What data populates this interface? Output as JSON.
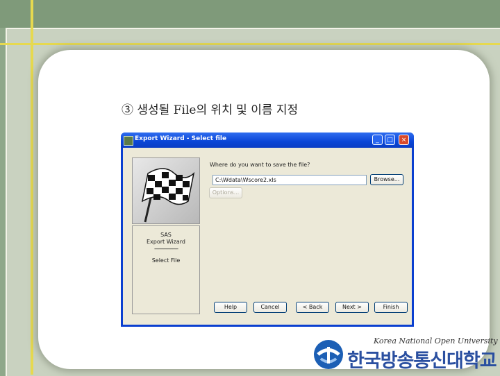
{
  "slide": {
    "title": "③ 생성될 File의 위치 및 이름 지정"
  },
  "dialog": {
    "title": "Export Wizard - Select file",
    "controls": {
      "minimize": "_",
      "maximize": "□",
      "close": "×"
    },
    "sidebar": {
      "line1": "SAS",
      "line2": "Export Wizard",
      "line3": "------------------",
      "line4": "Select File"
    },
    "question": "Where do you want to save the file?",
    "path_value": "C:\\Wdata\\Wscore2.xls",
    "buttons": {
      "browse": "Browse...",
      "options": "Options...",
      "help": "Help",
      "cancel": "Cancel",
      "back": "< Back",
      "next": "Next >",
      "finish": "Finish"
    }
  },
  "logo": {
    "english": "Korea National Open University",
    "korean": "한국방송통신대학교"
  },
  "colors": {
    "titlebar": "#0a45d6",
    "dialog_face": "#ece9d8",
    "frame_green": "#8fa88a",
    "accent_yellow": "#e6d94f"
  },
  "icons": {
    "flag": "checkered-flag-icon",
    "app": "sas-app-icon",
    "logo": "university-logo-icon"
  }
}
